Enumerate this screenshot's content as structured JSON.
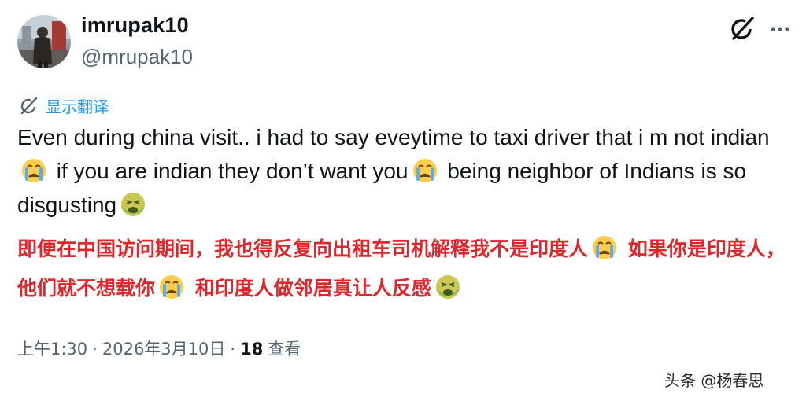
{
  "author": {
    "display_name": "imrupak10",
    "handle": "@mrupak10"
  },
  "actions": {
    "grok_icon": "grok-icon",
    "more_icon": "more-horizontal-icon"
  },
  "translate": {
    "label": "显示翻译"
  },
  "tweet": {
    "en_part1": "Even during china visit.. i had to say eveytime to taxi driver that i m not indian",
    "en_part2": " if you are indian they don’t want you",
    "en_part3": " being neighbor of Indians is so disgusting",
    "zh_part1": "即便在中国访问期间，我也得反复向出租车司机解释我不是印度人",
    "zh_part2": " 如果你是印度人，他们就不想载你",
    "zh_part3": " 和印度人做邻居真让人反感",
    "emojis": [
      "crying-face-emoji",
      "crying-face-emoji",
      "nauseated-face-emoji"
    ]
  },
  "meta": {
    "time": "上午1:30",
    "sep1": "·",
    "date": "2026年3月10日",
    "sep2": "·",
    "views_count": "18",
    "views_label": "查看"
  },
  "watermark": {
    "text": "头条 @杨春思"
  },
  "colors": {
    "text_primary": "#0f1419",
    "text_secondary": "#536471",
    "link_blue": "#1d9bf0",
    "translation_red": "#e0262b"
  }
}
